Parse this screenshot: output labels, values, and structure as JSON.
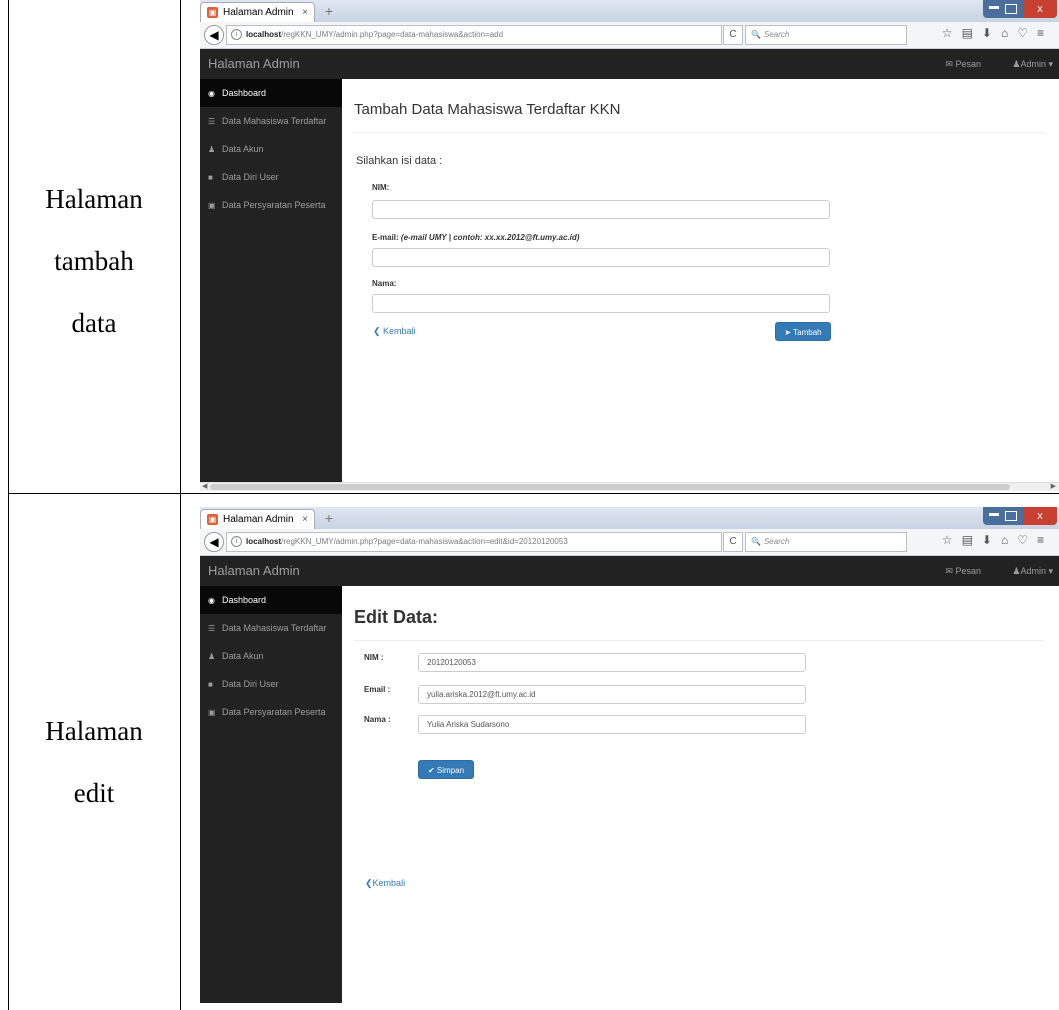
{
  "rows": [
    {
      "caption_lines": [
        "Halaman",
        "tambah",
        "data"
      ],
      "browser": {
        "tab_title": "Halaman Admin",
        "url_host": "localhost",
        "url_rest": "/regKKN_UMY/admin.php?page=data-mahasiswa&action=add",
        "search_placeholder": "Search"
      },
      "app": {
        "brand": "Halaman Admin",
        "pesan": "Pesan",
        "admin": "Admin ▾",
        "sidebar": [
          "Dashboard",
          "Data Mahasiswa Terdaftar",
          "Data Akun",
          "Data Diri User",
          "Data Persyaratan Peserta"
        ]
      },
      "page": {
        "title": "Tambah Data Mahasiswa Terdaftar KKN",
        "subtitle": "Silahkan isi data :",
        "nim_label": "NIM:",
        "email_label": "E-mail:",
        "email_hint": "(e-mail UMY | contoh: xx.xx.2012@ft.umy.ac.id)",
        "nama_label": "Nama:",
        "back": "Kembali",
        "submit": "Tambah"
      }
    },
    {
      "caption_lines": [
        "Halaman",
        "edit"
      ],
      "browser": {
        "tab_title": "Halaman Admin",
        "url_host": "localhost",
        "url_rest": "/regKKN_UMY/admin.php?page=data-mahasiswa&action=edit&id=20120120053",
        "search_placeholder": "Search"
      },
      "app": {
        "brand": "Halaman Admin",
        "pesan": "Pesan",
        "admin": "Admin ▾",
        "sidebar": [
          "Dashboard",
          "Data Mahasiswa Terdaftar",
          "Data Akun",
          "Data Diri User",
          "Data Persyaratan Peserta"
        ]
      },
      "page": {
        "title": "Edit Data:",
        "fields": [
          {
            "label": "NIM :",
            "value": "20120120053"
          },
          {
            "label": "Email :",
            "value": "yulia.ariska.2012@ft.umy.ac.id"
          },
          {
            "label": "Nama :",
            "value": "Yulia Ariska Sudarsono"
          }
        ],
        "submit": "Simpan",
        "back": "Kembali"
      }
    }
  ]
}
